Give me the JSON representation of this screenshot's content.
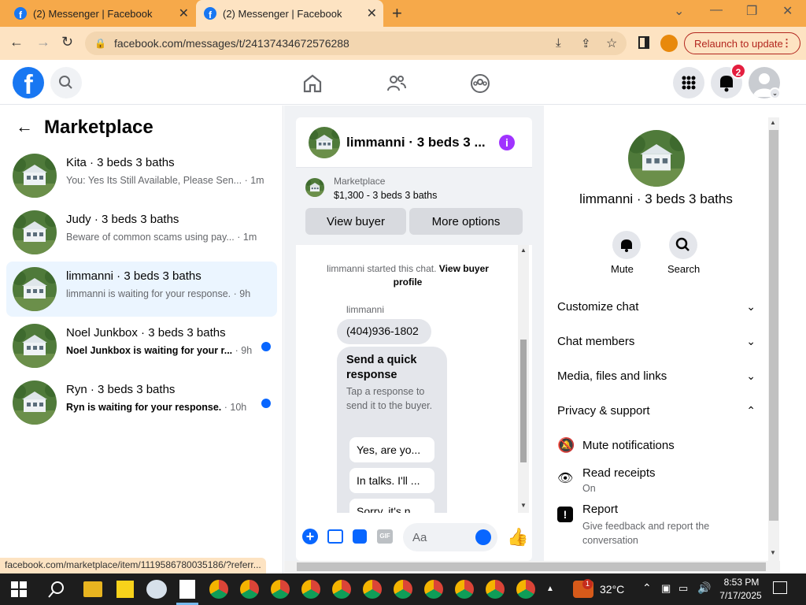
{
  "browser": {
    "tabs": [
      {
        "title": "(2) Messenger | Facebook",
        "active": false
      },
      {
        "title": "(2) Messenger | Facebook",
        "active": true
      }
    ],
    "url": "facebook.com/messages/t/24137434672576288",
    "relaunch_label": "Relaunch to update"
  },
  "fb_header": {
    "notification_count": "2"
  },
  "left_panel": {
    "title": "Marketplace",
    "conversations": [
      {
        "name": "Kita · 3 beds 3 baths",
        "preview": "You: Yes Its Still Available, Please Sen...",
        "time": "· 1m",
        "unread": false,
        "active": false
      },
      {
        "name": "Judy · 3 beds 3 baths",
        "preview": "Beware of common scams using pay...",
        "time": "· 1m",
        "unread": false,
        "active": false
      },
      {
        "name": "limmanni · 3 beds 3 baths",
        "preview": "limmanni is waiting for your response.",
        "time": "· 9h",
        "unread": false,
        "active": true
      },
      {
        "name": "Noel Junkbox · 3 beds 3 baths",
        "preview": "Noel Junkbox is waiting for your r...",
        "time": "· 9h",
        "unread": true,
        "active": false
      },
      {
        "name": "Ryn · 3 beds 3 baths",
        "preview": "Ryn is waiting for your response.",
        "time": "· 10h",
        "unread": true,
        "active": false
      }
    ]
  },
  "chat": {
    "title": "limmanni · 3 beds 3 ...",
    "listing_source": "Marketplace",
    "listing_title": "$1,300 - 3 beds 3 baths",
    "view_buyer_label": "View buyer",
    "more_options_label": "More options",
    "system_message": "limmanni started this chat.",
    "system_link": "View buyer profile",
    "sender": "limmanni",
    "phone_message": "(404)936-1802",
    "quick_response_title": "Send a quick response",
    "quick_response_sub": "Tap a response to send it to the buyer.",
    "quick_replies": [
      "Yes, are yo...",
      "In talks. I'll ...",
      "Sorry, it's n..."
    ],
    "composer_placeholder": "Aa"
  },
  "right_panel": {
    "name": "limmanni · 3 beds 3 baths",
    "mute_label": "Mute",
    "search_label": "Search",
    "sections": [
      {
        "label": "Customize chat",
        "expanded": false
      },
      {
        "label": "Chat members",
        "expanded": false
      },
      {
        "label": "Media, files and links",
        "expanded": false
      },
      {
        "label": "Privacy & support",
        "expanded": true
      }
    ],
    "privacy_items": [
      {
        "label": "Mute notifications",
        "sub": ""
      },
      {
        "label": "Read receipts",
        "sub": "On"
      },
      {
        "label": "Report",
        "sub": "Give feedback and report the conversation"
      }
    ]
  },
  "status_url": "facebook.com/marketplace/item/1119586780035186/?referr...",
  "taskbar": {
    "weather": "32°C",
    "time": "8:53 PM",
    "date": "7/17/2025",
    "weather_badge": "1"
  },
  "colors": {
    "brand": "#1877f2",
    "accent_purple": "#a033ff",
    "unread_dot": "#0866ff",
    "active_row": "#ebf5ff"
  }
}
